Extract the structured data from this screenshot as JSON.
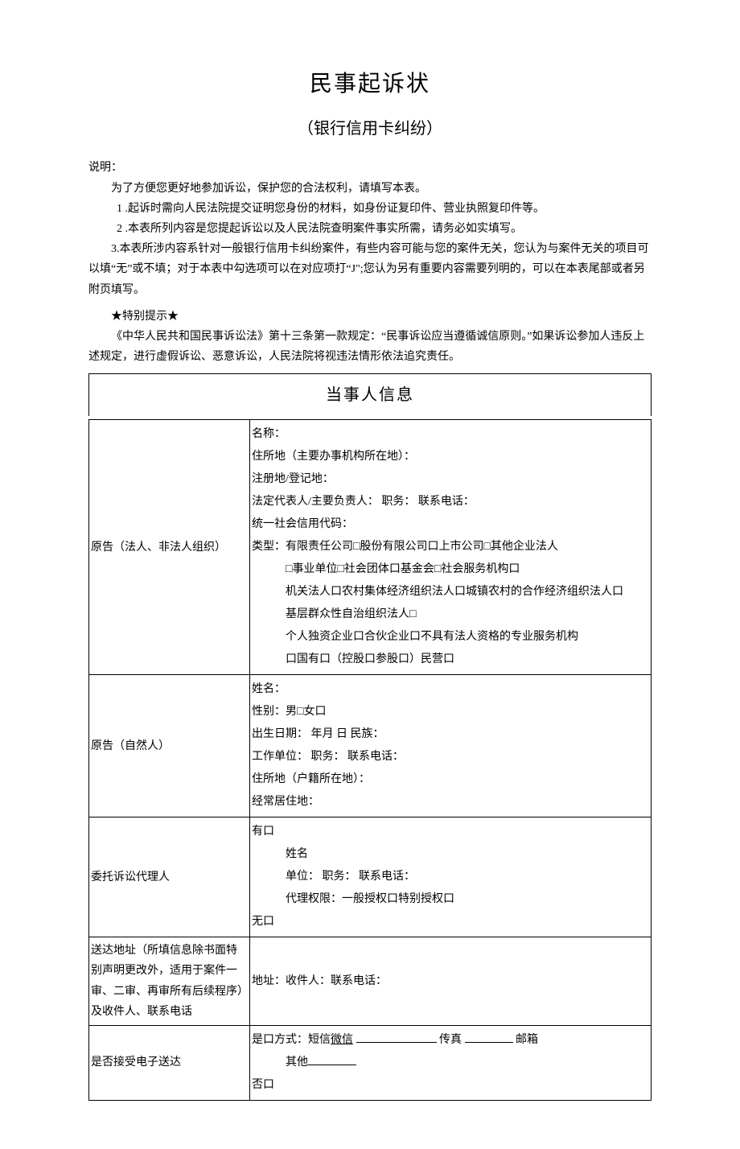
{
  "title": "民事起诉状",
  "subtitle": "（银行信用卡纠纷）",
  "intro_label": "说明：",
  "intro_lines": [
    "为了方便您更好地参加诉讼，保护您的合法权利，请填写本表。",
    "1 .起诉时需向人民法院提交证明您身份的材料，如身份证复印件、营业执照复印件等。",
    "2  .本表所列内容是您提起诉讼以及人民法院查明案件事实所需，请务必如实填写。",
    "3.本表所涉内容系针对一般银行信用卡纠纷案件，有些内容可能与您的案件无关，您认为与案件无关的项目可以填“无”或不填；对于本表中勾选项可以在对应项打“J\";您认为另有重要内容需要列明的，可以在本表尾部或者另附页填写。"
  ],
  "notice_label": "★特别提示★",
  "notice_text": "《中华人民共和国民事诉讼法》第十三条第一款规定：“民事诉讼应当遵循诚信原则。”如果诉讼参加人违反上述规定，进行虚假诉讼、恶意诉讼，人民法院将视违法情形依法追究责任。",
  "section_header": "当事人信息",
  "rows": {
    "r1_label": "原告（法人、非法人组织）",
    "r1": {
      "l1": "名称：",
      "l2": "住所地（主要办事机构所在地）：",
      "l3": "注册地/登记地：",
      "l4": "法定代表人/主要负责人：        职务：        联系电话：",
      "l5": "统一社会信用代码：",
      "l6": "类型：有限责任公司□股份有限公司口上市公司□其他企业法人",
      "l7": "□事业单位□社会团体口基金会□社会服务机构口",
      "l8": "机关法人口农村集体经济组织法人口城镇农村的合作经济组织法人口",
      "l9": "基层群众性自治组织法人□",
      "l10": "个人独资企业口合伙企业口不具有法人资格的专业服务机构",
      "l11": "口国有口（控股口参股口）民营口"
    },
    "r2_label": "原告（自然人）",
    "r2": {
      "l1": "姓名：",
      "l2": "性别：男□女口",
      "l3": "出生日期：      年月            日                 民族：",
      "l4": "工作单位：           职务：                 联系电话：",
      "l5": "住所地（户籍所在地）：",
      "l6": "经常居住地："
    },
    "r3_label": "委托诉讼代理人",
    "r3": {
      "l1": "有口",
      "l2": "姓名",
      "l3": "单位：               职务：               联系电话：",
      "l4": "代理权限：一般授权口特别授权口",
      "l5": "无口"
    },
    "r4_label": "送达地址（所填信息除书面特别声明更改外，适用于案件一审、二审、再审所有后续程序）及收件人、联系电话",
    "r4": {
      "l1": "地址：收件人：联系电话："
    },
    "r5_label": "是否接受电子送达",
    "r5": {
      "l1a": "是口方式：短信",
      "l1b": "微信",
      "l1c": "传真",
      "l1d": "邮箱",
      "l2": "其他",
      "l3": "否口"
    }
  }
}
